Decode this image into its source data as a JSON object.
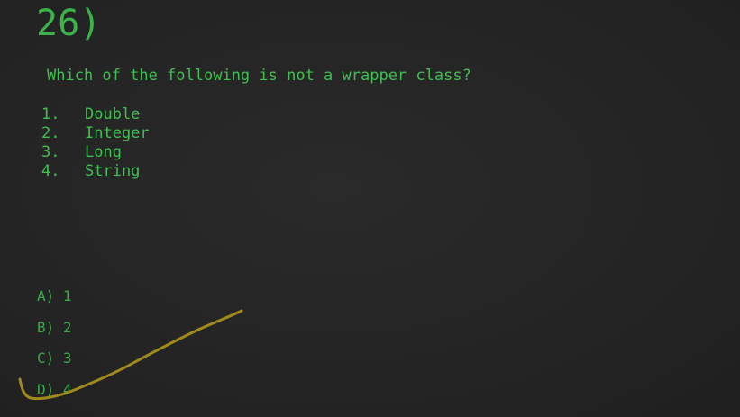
{
  "question": {
    "number": "26)",
    "text": "Which of the following is not a wrapper class?"
  },
  "options": [
    {
      "num": "1.",
      "label": "Double"
    },
    {
      "num": "2.",
      "label": "Integer"
    },
    {
      "num": "3.",
      "label": "Long"
    },
    {
      "num": "4.",
      "label": "String"
    }
  ],
  "answers": [
    {
      "label": "A) 1"
    },
    {
      "label": "B) 2"
    },
    {
      "label": "C) 3"
    },
    {
      "label": "D) 4"
    }
  ],
  "colors": {
    "background": "#262626",
    "text": "#40c050",
    "annotation": "#a08a1e"
  }
}
